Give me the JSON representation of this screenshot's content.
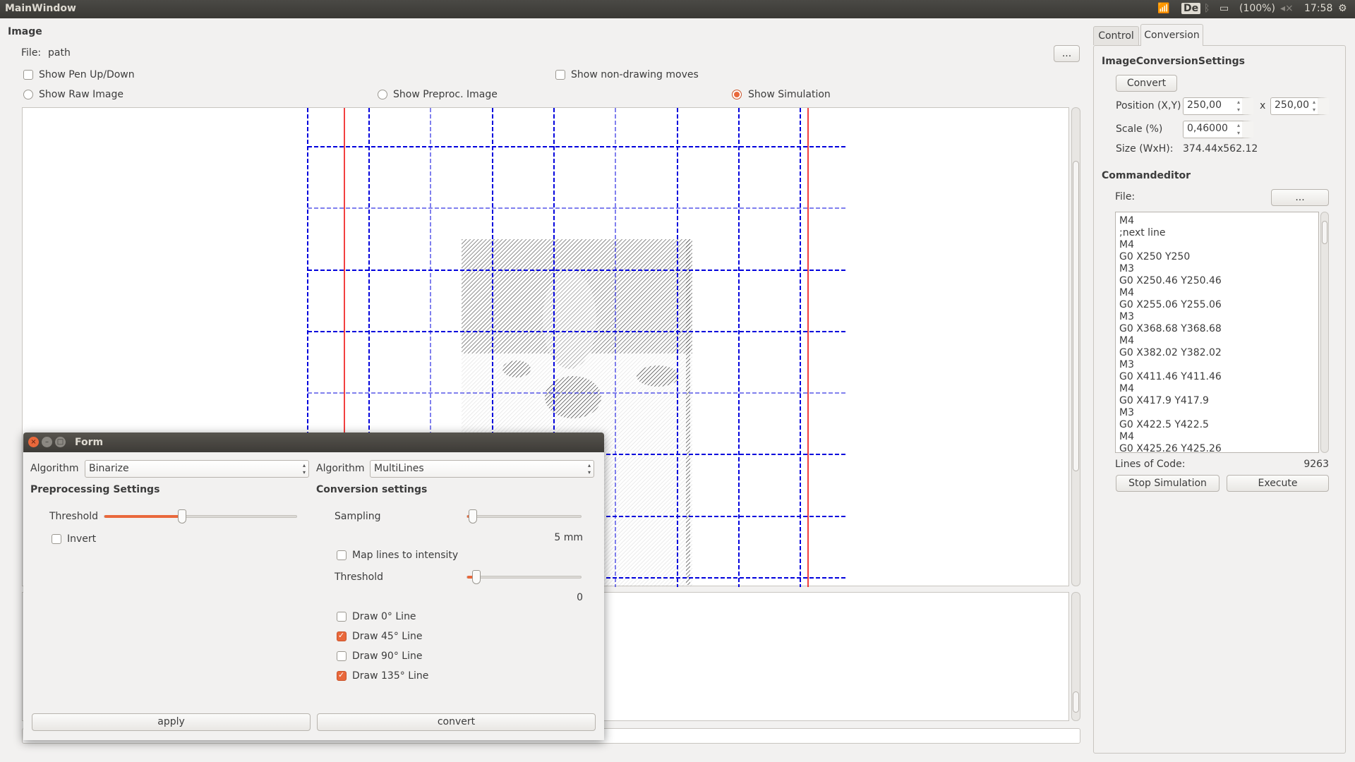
{
  "system_bar": {
    "window_title": "MainWindow",
    "keyboard": "De",
    "battery": "(100%)",
    "time": "17:58",
    "icons": [
      "wifi-icon",
      "bluetooth-icon",
      "battery-icon",
      "volume-muted-icon",
      "gear-icon"
    ]
  },
  "image_panel": {
    "title": "Image",
    "file_label": "File:",
    "file_value": "path",
    "browse_label": "...",
    "checkboxes": [
      {
        "label": "Show Pen Up/Down",
        "checked": false
      },
      {
        "label": "Show non-drawing moves",
        "checked": false
      }
    ],
    "radios": [
      {
        "label": "Show Raw Image",
        "checked": false
      },
      {
        "label": "Show Preproc. Image",
        "checked": false
      },
      {
        "label": "Show Simulation",
        "checked": true
      }
    ],
    "colors": {
      "grid": "#0000dd",
      "limits": "#ee0000",
      "accent": "#e9683b"
    }
  },
  "tabs": [
    {
      "label": "Control",
      "active": false
    },
    {
      "label": "Conversion",
      "active": true
    }
  ],
  "conversion": {
    "title": "ImageConversionSettings",
    "convert_label": "Convert",
    "position_label": "Position (X,Y)",
    "pos_x": "250,00",
    "x_sep": "x",
    "pos_y": "250,00",
    "scale_label": "Scale (%)",
    "scale": "0,46000",
    "size_label": "Size (WxH):",
    "size": "374.44x562.12"
  },
  "commandeditor": {
    "title": "Commandeditor",
    "file_label": "File:",
    "browse_label": "...",
    "lines": [
      "M4",
      ";next line",
      "M4",
      "G0 X250 Y250",
      "M3",
      "G0 X250.46 Y250.46",
      "M4",
      "G0 X255.06 Y255.06",
      "M3",
      "G0 X368.68 Y368.68",
      "M4",
      "G0 X382.02 Y382.02",
      "M3",
      "G0 X411.46 Y411.46",
      "M4",
      "G0 X417.9 Y417.9",
      "M3",
      "G0 X422.5 Y422.5",
      "M4",
      "G0 X425.26 Y425.26"
    ],
    "loc_label": "Lines of Code:",
    "loc": "9263",
    "stop_label": "Stop Simulation",
    "execute_label": "Execute"
  },
  "form": {
    "title": "Form",
    "pre_algorithm_label": "Algorithm",
    "pre_algorithm": "Binarize",
    "conv_algorithm_label": "Algorithm",
    "conv_algorithm": "MultiLines",
    "pre_title": "Preprocessing Settings",
    "threshold_label": "Threshold",
    "threshold_level": 0.4,
    "invert_label": "Invert",
    "invert": false,
    "conv_title": "Conversion settings",
    "sampling_label": "Sampling",
    "sampling_level": 0.05,
    "sampling_value": "5 mm",
    "map_label": "Map lines to intensity",
    "map": false,
    "threshold2_label": "Threshold",
    "threshold2_level": 0.08,
    "threshold2_value": "0",
    "draw_lines": [
      {
        "label": "Draw 0° Line",
        "checked": false
      },
      {
        "label": "Draw 45° Line",
        "checked": true
      },
      {
        "label": "Draw 90° Line",
        "checked": false
      },
      {
        "label": "Draw 135° Line",
        "checked": true
      }
    ],
    "apply_label": "apply",
    "convert_label": "convert"
  }
}
